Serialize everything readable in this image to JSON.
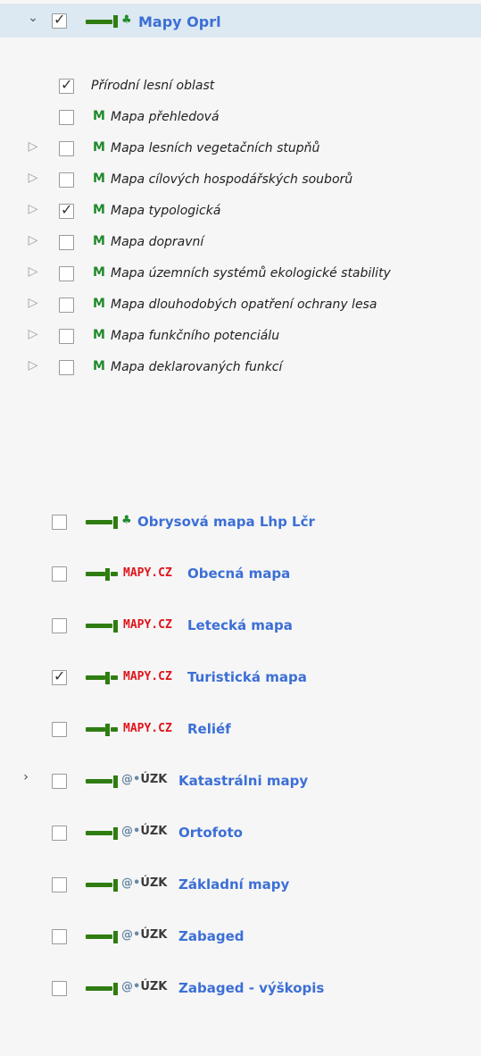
{
  "root": {
    "label": "Mapy Oprl",
    "checked": true,
    "expanded": true
  },
  "sublayers": [
    {
      "label": "Přírodní lesní oblast",
      "checked": true,
      "badge": "",
      "expandable": false
    },
    {
      "label": "Mapa přehledová",
      "checked": false,
      "badge": "M",
      "expandable": false
    },
    {
      "label": "Mapa lesních  vegetačních stupňů",
      "checked": false,
      "badge": "M",
      "expandable": true
    },
    {
      "label": "Mapa cílových hospodářských souborů",
      "checked": false,
      "badge": "M",
      "expandable": true
    },
    {
      "label": "Mapa typologická",
      "checked": true,
      "badge": "M",
      "expandable": true
    },
    {
      "label": "Mapa dopravní",
      "checked": false,
      "badge": "M",
      "expandable": true
    },
    {
      "label": "Mapa územních systémů ekologické stability",
      "checked": false,
      "badge": "M",
      "expandable": true
    },
    {
      "label": "Mapa dlouhodobých opatření ochrany lesa",
      "checked": false,
      "badge": "M",
      "expandable": true
    },
    {
      "label": "Mapa funkčního potenciálu",
      "checked": false,
      "badge": "M",
      "expandable": true
    },
    {
      "label": "Mapa deklarovaných funkcí",
      "checked": false,
      "badge": "M",
      "expandable": true
    }
  ],
  "layers": [
    {
      "label": "Obrysová mapa Lhp Lčr",
      "checked": false,
      "source": "tree",
      "source_text": "",
      "expandable": false,
      "bar": "solid"
    },
    {
      "label": "Obecná mapa",
      "checked": false,
      "source": "mapycz",
      "source_text": "MAPY.CZ",
      "expandable": false,
      "bar": "split"
    },
    {
      "label": "Letecká mapa",
      "checked": false,
      "source": "mapycz",
      "source_text": "MAPY.CZ",
      "expandable": false,
      "bar": "solid"
    },
    {
      "label": "Turistická mapa",
      "checked": true,
      "source": "mapycz",
      "source_text": "MAPY.CZ",
      "expandable": false,
      "bar": "split"
    },
    {
      "label": "Reliéf",
      "checked": false,
      "source": "mapycz",
      "source_text": "MAPY.CZ",
      "expandable": false,
      "bar": "split"
    },
    {
      "label": "Katastrálni mapy",
      "checked": false,
      "source": "cuzk",
      "source_text": "ÚZK",
      "expandable": true,
      "bar": "solid"
    },
    {
      "label": "Ortofoto",
      "checked": false,
      "source": "cuzk",
      "source_text": "ÚZK",
      "expandable": false,
      "bar": "solid"
    },
    {
      "label": "Základní mapy",
      "checked": false,
      "source": "cuzk",
      "source_text": "ÚZK",
      "expandable": false,
      "bar": "solid"
    },
    {
      "label": "Zabaged",
      "checked": false,
      "source": "cuzk",
      "source_text": "ÚZK",
      "expandable": false,
      "bar": "solid"
    },
    {
      "label": "Zabaged - výškopis",
      "checked": false,
      "source": "cuzk",
      "source_text": "ÚZK",
      "expandable": false,
      "bar": "solid"
    }
  ],
  "colors": {
    "layer_bar": "#2f7d12",
    "layer_bar_accent": "#d8c000",
    "link_blue": "#3c6fd6",
    "badge_green": "#1f8a2a",
    "mapy_red": "#e0131b"
  }
}
